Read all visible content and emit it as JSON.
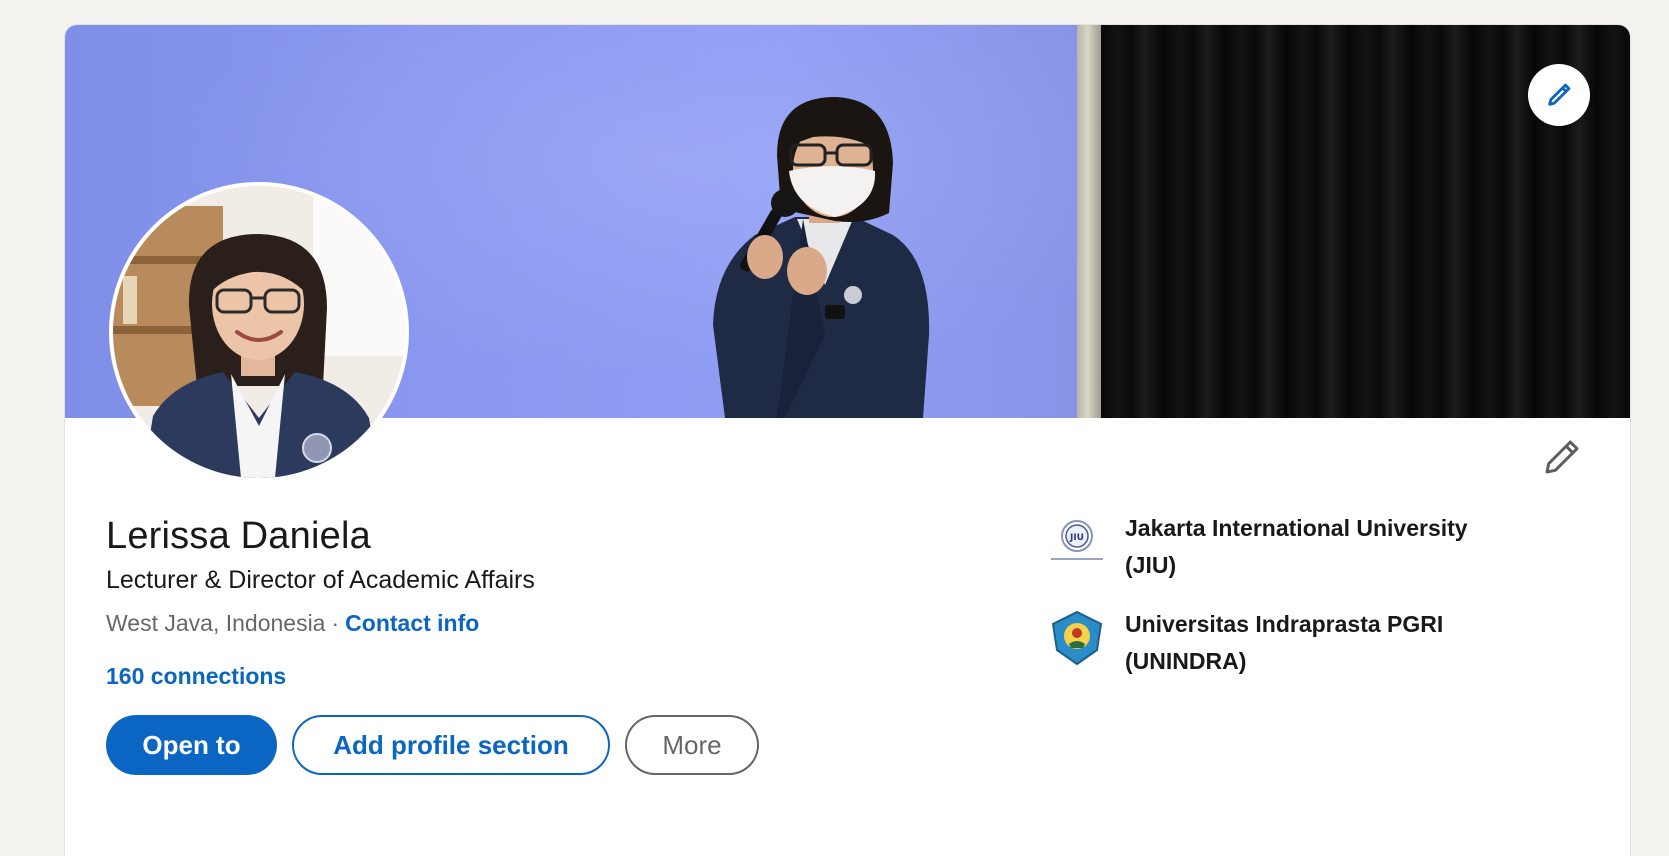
{
  "profile": {
    "name": "Lerissa Daniela",
    "headline": "Lecturer & Director of Academic Affairs",
    "location": "West Java, Indonesia",
    "separator": "·",
    "contact_label": "Contact info",
    "connections": "160 connections"
  },
  "actions": {
    "open_to": "Open to",
    "add_section": "Add profile section",
    "more": "More"
  },
  "organizations": [
    {
      "name": "Jakarta International University (JIU)",
      "logo": "jiu-logo-icon"
    },
    {
      "name": "Universitas Indraprasta PGRI (UNINDRA)",
      "logo": "unindra-logo-icon"
    }
  ],
  "logo_text": {
    "jiu": "JIU"
  },
  "icons": {
    "cover_edit": "pencil-icon",
    "intro_edit": "pencil-outline-icon"
  },
  "colors": {
    "brand_blue": "#0a66c2",
    "page_bg": "#f3f2ef"
  }
}
